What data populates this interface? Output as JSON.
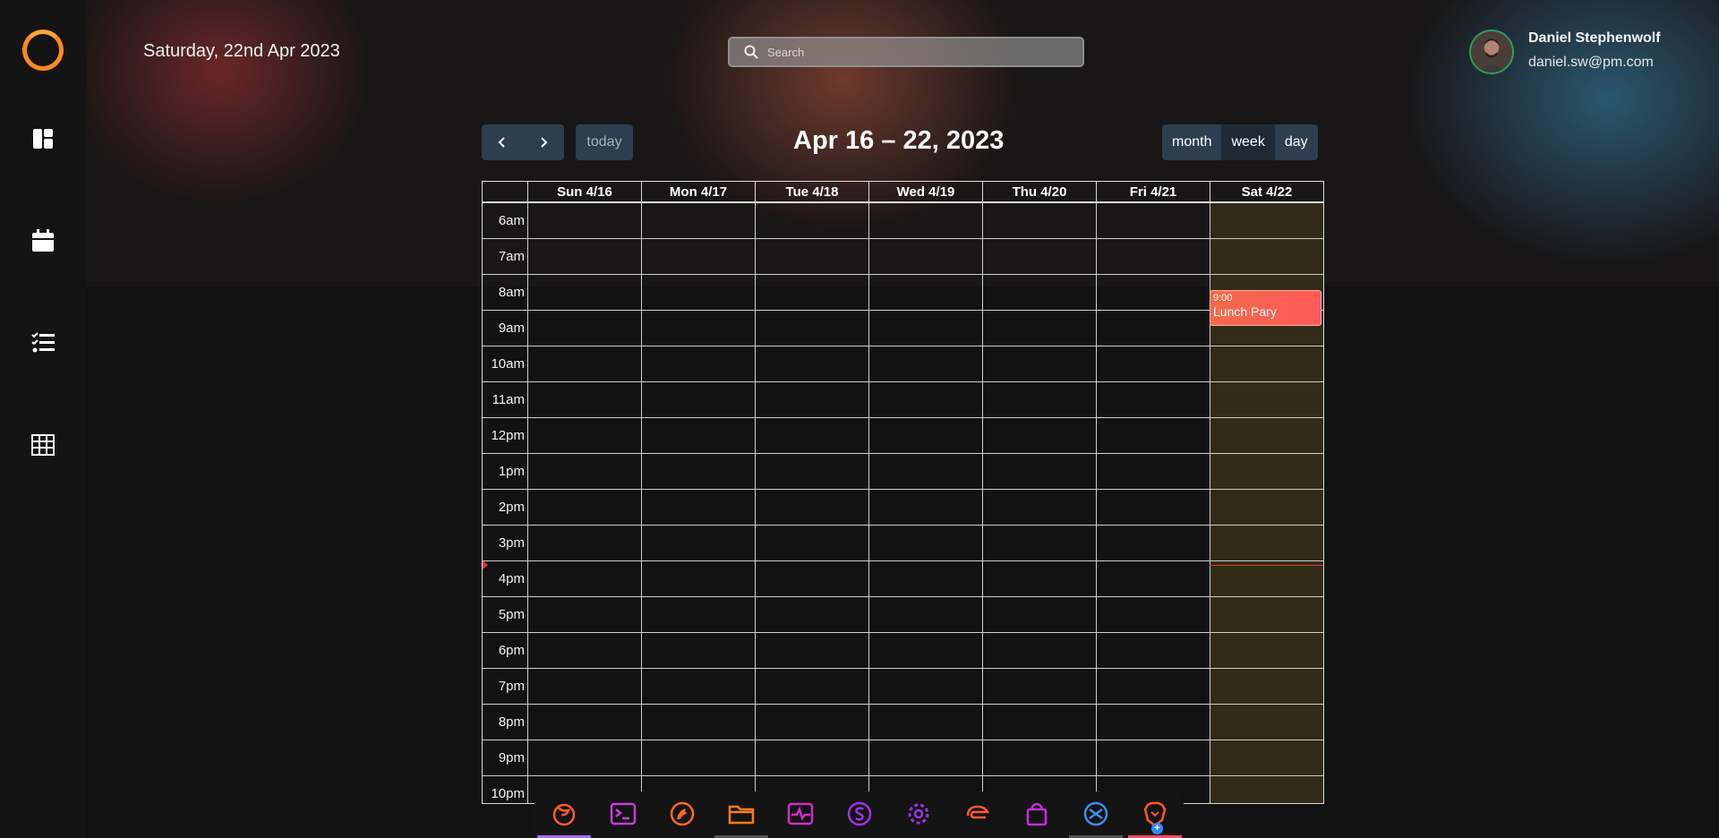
{
  "header": {
    "date": "Saturday, 22nd Apr 2023",
    "search_placeholder": "Search"
  },
  "user": {
    "name": "Daniel Stephenwolf",
    "email": "daniel.sw@pm.com"
  },
  "sidebar": {
    "items": [
      {
        "icon": "dashboard-icon"
      },
      {
        "icon": "calendar-icon"
      },
      {
        "icon": "tasks-icon"
      },
      {
        "icon": "table-icon"
      }
    ]
  },
  "calendar": {
    "title": "Apr 16 – 22, 2023",
    "today_label": "today",
    "views": [
      "month",
      "week",
      "day"
    ],
    "active_view": "week",
    "days": [
      "Sun 4/16",
      "Mon 4/17",
      "Tue 4/18",
      "Wed 4/19",
      "Thu 4/20",
      "Fri 4/21",
      "Sat 4/22"
    ],
    "today_column": "Sat 4/22",
    "hours": [
      "6am",
      "7am",
      "8am",
      "9am",
      "10am",
      "11am",
      "12pm",
      "1pm",
      "2pm",
      "3pm",
      "4pm",
      "5pm",
      "6pm",
      "7pm",
      "8pm",
      "9pm",
      "10pm"
    ],
    "events": [
      {
        "time": "9:00",
        "title": "Lunch Pary",
        "day": "Sat 4/22",
        "color": "#f3674c"
      }
    ],
    "today_highlight_color": "#322b18",
    "now_indicator_color": "#e43535"
  },
  "dock": {
    "apps": [
      {
        "name": "firefox-icon",
        "color": "#ff5a2c",
        "active": true
      },
      {
        "name": "terminal-icon",
        "color": "#c53fd8"
      },
      {
        "name": "dragon-icon",
        "color": "#ff6a1a"
      },
      {
        "name": "files-icon",
        "color": "#ff7a1a"
      },
      {
        "name": "monitor-icon",
        "color": "#cc2fc8"
      },
      {
        "name": "s-app-icon",
        "color": "#a032e6"
      },
      {
        "name": "settings-icon",
        "color": "#a032e6"
      },
      {
        "name": "ide-icon",
        "color": "#ff5a2c"
      },
      {
        "name": "store-icon",
        "color": "#c22fd8"
      },
      {
        "name": "vscode-icon",
        "color": "#3f8ef0"
      },
      {
        "name": "brave-icon",
        "color": "#ff5a1a"
      }
    ]
  },
  "colors": {
    "accent": "#ff8a1e",
    "button_bg": "#2c3e50",
    "background": "#121212"
  }
}
